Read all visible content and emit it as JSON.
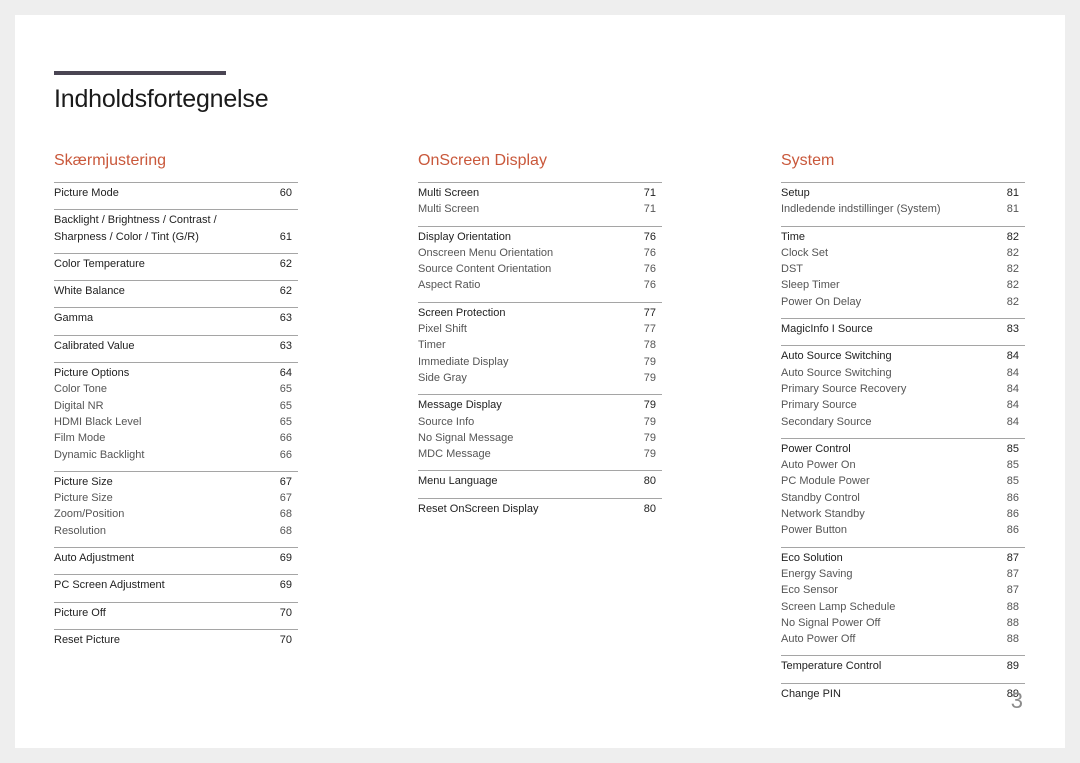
{
  "document": {
    "title": "Indholdsfortegnelse",
    "page_number": "3",
    "accent_color": "#c9583b",
    "bar_color": "#4a4553"
  },
  "columns": [
    {
      "heading": "Skærmjustering",
      "groups": [
        {
          "items": [
            {
              "label": "Picture Mode",
              "page": "60",
              "main": true
            }
          ]
        },
        {
          "items": [
            {
              "label": "Backlight / Brightness / Contrast /\nSharpness / Color / Tint (G/R)",
              "page": "61",
              "main": true
            }
          ]
        },
        {
          "items": [
            {
              "label": "Color Temperature",
              "page": "62",
              "main": true
            }
          ]
        },
        {
          "items": [
            {
              "label": "White Balance",
              "page": "62",
              "main": true
            }
          ]
        },
        {
          "items": [
            {
              "label": "Gamma",
              "page": "63",
              "main": true
            }
          ]
        },
        {
          "items": [
            {
              "label": "Calibrated Value",
              "page": "63",
              "main": true
            }
          ]
        },
        {
          "items": [
            {
              "label": "Picture Options",
              "page": "64",
              "main": true
            },
            {
              "label": "Color Tone",
              "page": "65",
              "main": false
            },
            {
              "label": "Digital NR",
              "page": "65",
              "main": false
            },
            {
              "label": "HDMI Black Level",
              "page": "65",
              "main": false
            },
            {
              "label": "Film Mode",
              "page": "66",
              "main": false
            },
            {
              "label": "Dynamic Backlight",
              "page": "66",
              "main": false
            }
          ]
        },
        {
          "items": [
            {
              "label": "Picture Size",
              "page": "67",
              "main": true
            },
            {
              "label": "Picture Size",
              "page": "67",
              "main": false
            },
            {
              "label": "Zoom/Position",
              "page": "68",
              "main": false
            },
            {
              "label": "Resolution",
              "page": "68",
              "main": false
            }
          ]
        },
        {
          "items": [
            {
              "label": "Auto Adjustment",
              "page": "69",
              "main": true
            }
          ]
        },
        {
          "items": [
            {
              "label": "PC Screen Adjustment",
              "page": "69",
              "main": true
            }
          ]
        },
        {
          "items": [
            {
              "label": "Picture Off",
              "page": "70",
              "main": true
            }
          ]
        },
        {
          "items": [
            {
              "label": "Reset Picture",
              "page": "70",
              "main": true
            }
          ]
        }
      ]
    },
    {
      "heading": "OnScreen Display",
      "groups": [
        {
          "items": [
            {
              "label": "Multi Screen",
              "page": "71",
              "main": true
            },
            {
              "label": "Multi Screen",
              "page": "71",
              "main": false
            }
          ]
        },
        {
          "items": [
            {
              "label": "Display Orientation",
              "page": "76",
              "main": true
            },
            {
              "label": "Onscreen Menu Orientation",
              "page": "76",
              "main": false
            },
            {
              "label": "Source Content Orientation",
              "page": "76",
              "main": false
            },
            {
              "label": "Aspect Ratio",
              "page": "76",
              "main": false
            }
          ]
        },
        {
          "items": [
            {
              "label": "Screen Protection",
              "page": "77",
              "main": true
            },
            {
              "label": "Pixel Shift",
              "page": "77",
              "main": false
            },
            {
              "label": "Timer",
              "page": "78",
              "main": false
            },
            {
              "label": "Immediate Display",
              "page": "79",
              "main": false
            },
            {
              "label": "Side Gray",
              "page": "79",
              "main": false
            }
          ]
        },
        {
          "items": [
            {
              "label": "Message Display",
              "page": "79",
              "main": true
            },
            {
              "label": "Source Info",
              "page": "79",
              "main": false
            },
            {
              "label": "No Signal Message",
              "page": "79",
              "main": false
            },
            {
              "label": "MDC Message",
              "page": "79",
              "main": false
            }
          ]
        },
        {
          "items": [
            {
              "label": "Menu Language",
              "page": "80",
              "main": true
            }
          ]
        },
        {
          "items": [
            {
              "label": "Reset OnScreen Display",
              "page": "80",
              "main": true
            }
          ]
        }
      ]
    },
    {
      "heading": "System",
      "groups": [
        {
          "items": [
            {
              "label": "Setup",
              "page": "81",
              "main": true
            },
            {
              "label": "Indledende indstillinger (System)",
              "page": "81",
              "main": false
            }
          ]
        },
        {
          "items": [
            {
              "label": "Time",
              "page": "82",
              "main": true
            },
            {
              "label": "Clock Set",
              "page": "82",
              "main": false
            },
            {
              "label": "DST",
              "page": "82",
              "main": false
            },
            {
              "label": "Sleep Timer",
              "page": "82",
              "main": false
            },
            {
              "label": "Power On Delay",
              "page": "82",
              "main": false
            }
          ]
        },
        {
          "items": [
            {
              "label": "MagicInfo I Source",
              "page": "83",
              "main": true
            }
          ]
        },
        {
          "items": [
            {
              "label": "Auto Source Switching",
              "page": "84",
              "main": true
            },
            {
              "label": "Auto Source Switching",
              "page": "84",
              "main": false
            },
            {
              "label": "Primary Source Recovery",
              "page": "84",
              "main": false
            },
            {
              "label": "Primary Source",
              "page": "84",
              "main": false
            },
            {
              "label": "Secondary Source",
              "page": "84",
              "main": false
            }
          ]
        },
        {
          "items": [
            {
              "label": "Power Control",
              "page": "85",
              "main": true
            },
            {
              "label": "Auto Power On",
              "page": "85",
              "main": false
            },
            {
              "label": "PC Module Power",
              "page": "85",
              "main": false
            },
            {
              "label": "Standby Control",
              "page": "86",
              "main": false
            },
            {
              "label": "Network Standby",
              "page": "86",
              "main": false
            },
            {
              "label": "Power Button",
              "page": "86",
              "main": false
            }
          ]
        },
        {
          "items": [
            {
              "label": "Eco Solution",
              "page": "87",
              "main": true
            },
            {
              "label": "Energy Saving",
              "page": "87",
              "main": false
            },
            {
              "label": "Eco Sensor",
              "page": "87",
              "main": false
            },
            {
              "label": "Screen Lamp Schedule",
              "page": "88",
              "main": false
            },
            {
              "label": "No Signal Power Off",
              "page": "88",
              "main": false
            },
            {
              "label": "Auto Power Off",
              "page": "88",
              "main": false
            }
          ]
        },
        {
          "items": [
            {
              "label": "Temperature Control",
              "page": "89",
              "main": true
            }
          ]
        },
        {
          "items": [
            {
              "label": "Change PIN",
              "page": "89",
              "main": true
            }
          ]
        }
      ]
    }
  ]
}
